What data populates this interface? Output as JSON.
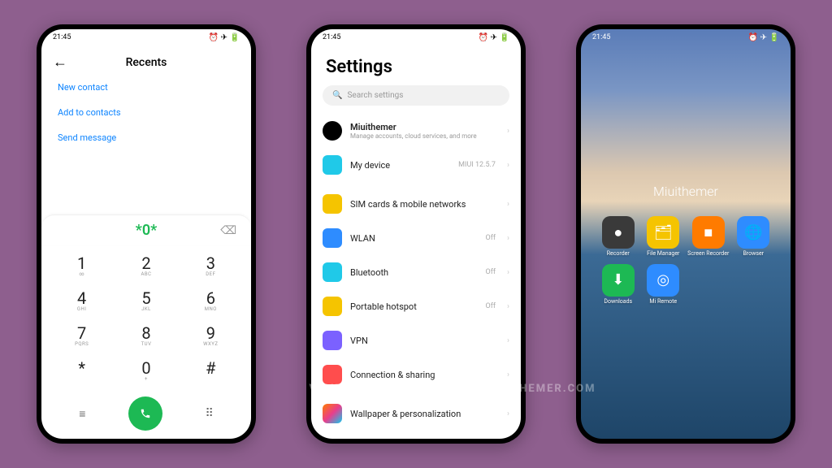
{
  "statusbar": {
    "time": "21:45"
  },
  "dialer": {
    "title": "Recents",
    "links": [
      "New contact",
      "Add to contacts",
      "Send message"
    ],
    "entered": "*0*",
    "keys": [
      {
        "n": "1",
        "s": "∞"
      },
      {
        "n": "2",
        "s": "ABC"
      },
      {
        "n": "3",
        "s": "DEF"
      },
      {
        "n": "4",
        "s": "GHI"
      },
      {
        "n": "5",
        "s": "JKL"
      },
      {
        "n": "6",
        "s": "MNO"
      },
      {
        "n": "7",
        "s": "PQRS"
      },
      {
        "n": "8",
        "s": "TUV"
      },
      {
        "n": "9",
        "s": "WXYZ"
      },
      {
        "n": "*",
        "s": ""
      },
      {
        "n": "0",
        "s": "+"
      },
      {
        "n": "#",
        "s": ""
      }
    ]
  },
  "settings": {
    "title": "Settings",
    "search_placeholder": "Search settings",
    "account": {
      "name": "Miuithemer",
      "sub": "Manage accounts, cloud services, and more"
    },
    "rows": [
      {
        "icon": "device",
        "color": "#20c9e8",
        "label": "My device",
        "meta": "MIUI 12.5.7"
      },
      {
        "divider": true
      },
      {
        "icon": "sim",
        "color": "#f5c400",
        "label": "SIM cards & mobile networks",
        "meta": ""
      },
      {
        "icon": "wlan",
        "color": "#2e8cff",
        "label": "WLAN",
        "meta": "Off"
      },
      {
        "icon": "bt",
        "color": "#20c9e8",
        "label": "Bluetooth",
        "meta": "Off"
      },
      {
        "icon": "hotspot",
        "color": "#f5c400",
        "label": "Portable hotspot",
        "meta": "Off"
      },
      {
        "icon": "vpn",
        "color": "#7b61ff",
        "label": "VPN",
        "meta": ""
      },
      {
        "icon": "conn",
        "color": "#ff4d4d",
        "label": "Connection & sharing",
        "meta": ""
      },
      {
        "divider": true
      },
      {
        "icon": "wall",
        "color": "linear-gradient(135deg,#ff7b00,#e83e8c,#0dcaf0)",
        "label": "Wallpaper & personalization",
        "meta": ""
      }
    ]
  },
  "home": {
    "title": "Miuithemer",
    "apps": [
      {
        "name": "Recorder",
        "color": "#3a3a3a",
        "glyph": "●"
      },
      {
        "name": "File Manager",
        "color": "#f5c400",
        "glyph": "🗂"
      },
      {
        "name": "Screen Recorder",
        "color": "#ff7b00",
        "glyph": "■"
      },
      {
        "name": "Browser",
        "color": "#2e8cff",
        "glyph": "🌐"
      },
      {
        "name": "Downloads",
        "color": "#1db954",
        "glyph": "⬇"
      },
      {
        "name": "Mi Remote",
        "color": "#2e8cff",
        "glyph": "◎"
      }
    ]
  },
  "watermark": "VISIT FOR MORE THEMES - MIUITHEMER.COM"
}
